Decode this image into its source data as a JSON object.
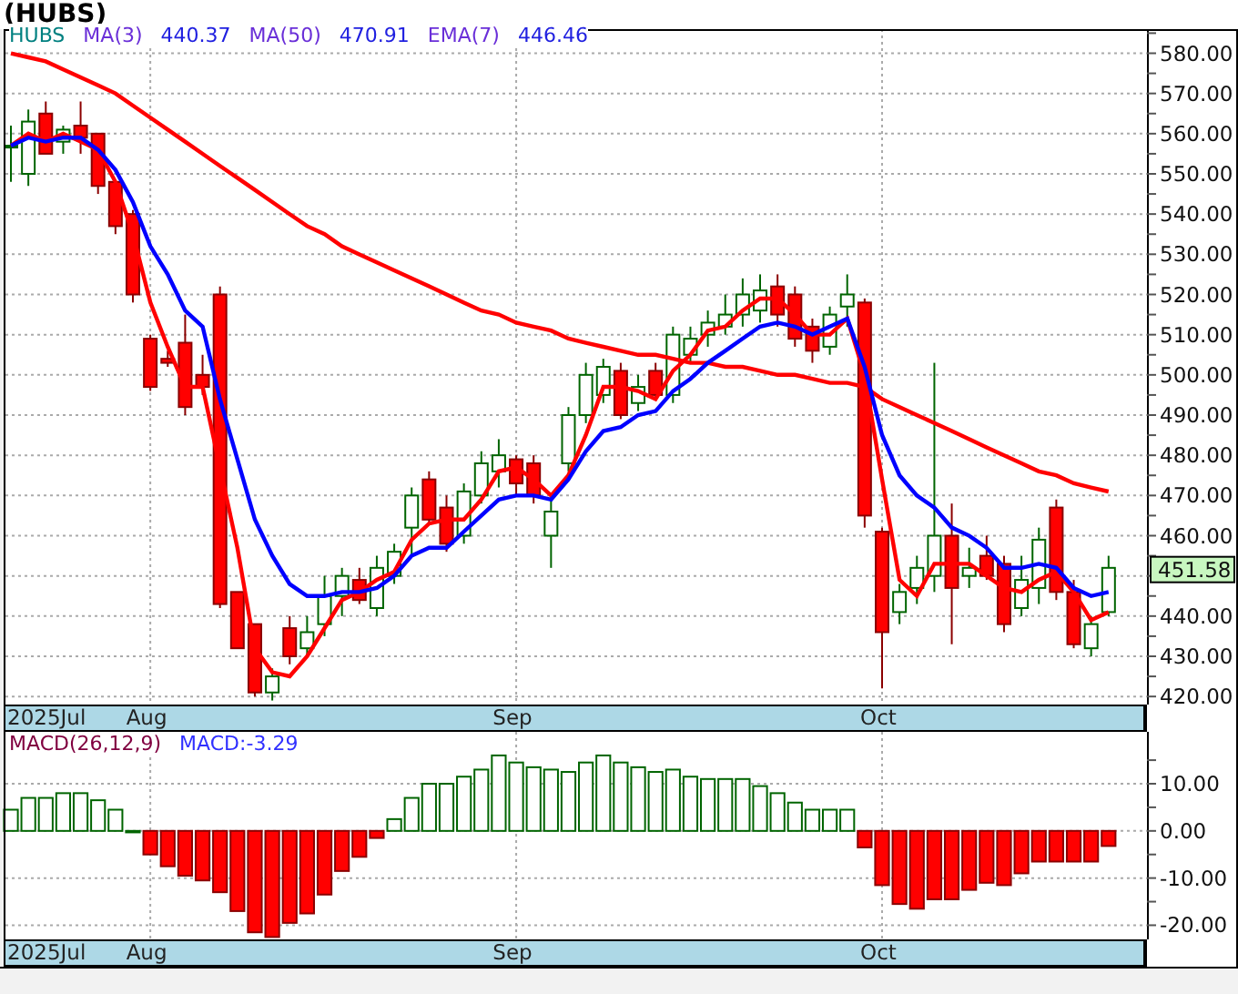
{
  "title": "(HUBS)",
  "price_panel": {
    "symbol": "HUBS",
    "legend_values": [
      "440.37",
      "470.91",
      "446.46"
    ],
    "last_price": "451.58",
    "date_labels": [
      "2025Jul",
      "Aug",
      "Sep",
      "Oct"
    ],
    "chart_data": {
      "type": "candlestick",
      "grid": true,
      "ylim": [
        418,
        586
      ],
      "ohlc": [
        [
          557,
          562,
          548,
          557
        ],
        [
          550,
          566,
          547,
          563
        ],
        [
          565,
          568,
          555,
          555
        ],
        [
          558,
          562,
          555,
          561
        ],
        [
          562,
          568,
          555,
          559
        ],
        [
          560,
          560,
          545,
          547
        ],
        [
          548,
          548,
          535,
          537
        ],
        [
          540,
          541,
          518,
          520
        ],
        [
          509,
          510,
          496,
          497
        ],
        [
          504,
          506,
          502,
          503
        ],
        [
          508,
          515,
          490,
          492
        ],
        [
          500,
          505,
          495,
          497
        ],
        [
          520,
          522,
          442,
          443
        ],
        [
          446,
          446,
          432,
          432
        ],
        [
          438,
          438,
          420,
          421
        ],
        [
          421,
          427,
          419,
          425
        ],
        [
          437,
          440,
          428,
          430
        ],
        [
          432,
          440,
          430,
          436
        ],
        [
          438,
          450,
          435,
          445
        ],
        [
          445,
          452,
          440,
          450
        ],
        [
          449,
          452,
          443,
          444
        ],
        [
          442,
          455,
          440,
          452
        ],
        [
          450,
          458,
          448,
          456
        ],
        [
          462,
          472,
          455,
          470
        ],
        [
          474,
          476,
          463,
          464
        ],
        [
          467,
          470,
          456,
          458
        ],
        [
          460,
          473,
          458,
          471
        ],
        [
          470,
          481,
          468,
          478
        ],
        [
          476,
          484,
          472,
          480
        ],
        [
          479,
          480,
          470,
          473
        ],
        [
          478,
          480,
          468,
          470
        ],
        [
          460,
          470,
          452,
          466
        ],
        [
          478,
          492,
          476,
          490
        ],
        [
          490,
          503,
          488,
          500
        ],
        [
          495,
          504,
          493,
          502
        ],
        [
          501,
          503,
          489,
          490
        ],
        [
          493,
          500,
          491,
          497
        ],
        [
          501,
          503,
          494,
          495
        ],
        [
          495,
          512,
          493,
          510
        ],
        [
          505,
          512,
          503,
          509
        ],
        [
          510,
          516,
          507,
          513
        ],
        [
          512,
          520,
          510,
          515
        ],
        [
          515,
          524,
          512,
          520
        ],
        [
          516,
          525,
          513,
          521
        ],
        [
          522,
          525,
          512,
          515
        ],
        [
          520,
          522,
          507,
          509
        ],
        [
          512,
          514,
          503,
          506
        ],
        [
          507,
          517,
          505,
          515
        ],
        [
          517,
          525,
          512,
          520
        ],
        [
          518,
          519,
          462,
          465
        ],
        [
          461,
          462,
          422,
          436
        ],
        [
          441,
          448,
          438,
          446
        ],
        [
          447,
          455,
          443,
          452
        ],
        [
          450,
          503,
          446,
          460
        ],
        [
          460,
          468,
          433,
          447
        ],
        [
          450,
          457,
          447,
          452
        ],
        [
          455,
          460,
          449,
          450
        ],
        [
          453,
          455,
          436,
          438
        ],
        [
          442,
          455,
          440,
          449
        ],
        [
          447,
          462,
          443,
          459
        ],
        [
          467,
          469,
          444,
          446
        ],
        [
          446,
          449,
          432,
          433
        ],
        [
          432,
          440,
          430,
          438
        ],
        [
          441,
          455,
          440,
          452
        ]
      ],
      "yticks": [
        {
          "value": 420,
          "label": "420.00"
        },
        {
          "value": 430,
          "label": "430.00"
        },
        {
          "value": 440,
          "label": "440.00"
        },
        {
          "value": 460,
          "label": "460.00"
        },
        {
          "value": 470,
          "label": "470.00"
        },
        {
          "value": 480,
          "label": "480.00"
        },
        {
          "value": 490,
          "label": "490.00"
        },
        {
          "value": 500,
          "label": "500.00"
        },
        {
          "value": 510,
          "label": "510.00"
        },
        {
          "value": 520,
          "label": "520.00"
        },
        {
          "value": 530,
          "label": "530.00"
        },
        {
          "value": 540,
          "label": "540.00"
        },
        {
          "value": 550,
          "label": "550.00"
        },
        {
          "value": 560,
          "label": "560.00"
        },
        {
          "value": 570,
          "label": "570.00"
        },
        {
          "value": 580,
          "label": "580.00"
        }
      ],
      "series": [
        {
          "name": "MA(3)",
          "type": "line",
          "color": "#ff0000",
          "values": [
            557,
            560,
            558,
            560,
            558,
            556,
            548,
            535,
            518,
            507,
            497,
            497,
            477,
            457,
            432,
            426,
            425,
            430,
            437,
            444,
            446,
            449,
            451,
            459,
            463,
            464,
            464,
            469,
            476,
            477,
            474,
            470,
            475,
            485,
            497,
            497,
            496,
            494,
            501,
            505,
            511,
            512,
            516,
            519,
            519,
            515,
            510,
            510,
            514,
            500,
            474,
            449,
            445,
            453,
            453,
            453,
            450,
            447,
            446,
            449,
            451,
            446,
            439,
            441
          ]
        },
        {
          "name": "MA(50)",
          "type": "line",
          "color": "#ff0000",
          "values": [
            580,
            579,
            578,
            576,
            574,
            572,
            570,
            567,
            564,
            561,
            558,
            555,
            552,
            549,
            546,
            543,
            540,
            537,
            535,
            532,
            530,
            528,
            526,
            524,
            522,
            520,
            518,
            516,
            515,
            513,
            512,
            511,
            509,
            508,
            507,
            506,
            505,
            505,
            504,
            503,
            503,
            502,
            502,
            501,
            500,
            500,
            499,
            498,
            498,
            497,
            494,
            492,
            490,
            488,
            486,
            484,
            482,
            480,
            478,
            476,
            475,
            473,
            472,
            471
          ]
        },
        {
          "name": "EMA(7)",
          "type": "line",
          "color": "#0000ff",
          "values": [
            557,
            559,
            558,
            559,
            559,
            556,
            551,
            543,
            532,
            525,
            516,
            512,
            494,
            479,
            464,
            455,
            448,
            445,
            445,
            446,
            446,
            447,
            450,
            455,
            457,
            457,
            461,
            465,
            469,
            470,
            470,
            469,
            474,
            481,
            486,
            487,
            490,
            491,
            496,
            499,
            503,
            506,
            509,
            512,
            513,
            512,
            510,
            512,
            514,
            502,
            485,
            475,
            470,
            467,
            462,
            460,
            457,
            452,
            452,
            453,
            452,
            447,
            445,
            446
          ]
        }
      ]
    }
  },
  "macd_panel": {
    "legend": [
      {
        "text": "MACD(26,12,9)",
        "color": "#800040"
      },
      {
        "text": "MACD:-3.29",
        "color": "#3030ff"
      }
    ],
    "date_labels": [
      "2025Jul",
      "Aug",
      "Sep",
      "Oct"
    ],
    "chart_data": {
      "type": "bar",
      "grid": true,
      "ylim": [
        -23,
        21
      ],
      "yticks": [
        {
          "value": 10,
          "label": "10.00"
        },
        {
          "value": 0,
          "label": "0.00"
        },
        {
          "value": -10,
          "label": "-10.00"
        },
        {
          "value": -20,
          "label": "-20.00"
        }
      ],
      "series": [
        {
          "color": "#006400",
          "values": [
            4.5,
            7,
            7,
            8,
            8,
            6.5,
            4.5,
            0,
            null,
            null,
            null,
            null,
            null,
            null,
            null,
            null,
            null,
            null,
            null,
            null,
            null,
            null,
            2.5,
            7,
            10,
            10,
            11.5,
            13,
            16,
            14.5,
            13.5,
            13,
            12.5,
            14.5,
            16,
            14.5,
            13.5,
            12.5,
            13,
            11.5,
            11,
            11,
            11,
            9.5,
            8,
            6,
            4.5,
            4.5,
            4.5,
            null,
            null,
            null,
            null,
            null,
            null,
            null,
            null,
            null,
            null,
            null,
            null,
            null,
            null,
            null
          ]
        },
        {
          "color": "#ff0000",
          "values": [
            null,
            null,
            null,
            null,
            null,
            null,
            null,
            null,
            -5,
            -7.5,
            -9.5,
            -10.5,
            -13,
            -17,
            -21.5,
            -22.5,
            -19.5,
            -17.5,
            -13.5,
            -8.5,
            -5.5,
            -1.5,
            null,
            null,
            null,
            null,
            null,
            null,
            null,
            null,
            null,
            null,
            null,
            null,
            null,
            null,
            null,
            null,
            null,
            null,
            null,
            null,
            null,
            null,
            null,
            null,
            null,
            null,
            null,
            -3.5,
            -11.5,
            -15.5,
            -16.5,
            -14.5,
            -14.5,
            -12.5,
            -11,
            -11.5,
            -9,
            -6.5,
            -6.5,
            -6.5,
            -6.5,
            -3.2
          ]
        }
      ]
    }
  }
}
